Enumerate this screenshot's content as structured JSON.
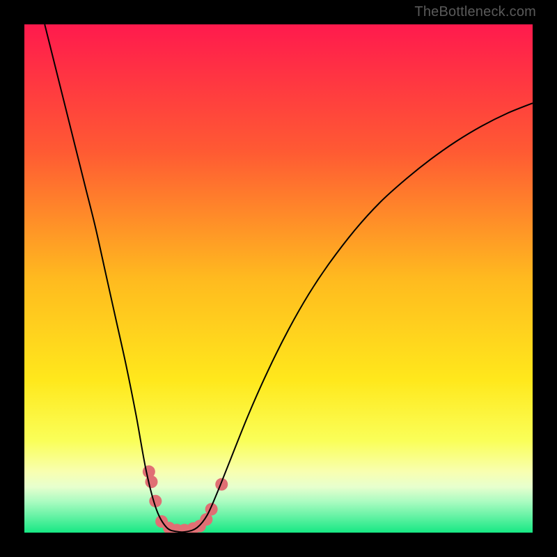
{
  "watermark": "TheBottleneck.com",
  "chart_data": {
    "type": "line",
    "title": "",
    "xlabel": "",
    "ylabel": "",
    "x_range": [
      0,
      100
    ],
    "y_range": [
      0,
      100
    ],
    "background_gradient": {
      "stops": [
        {
          "pos": 0.0,
          "color": "#ff1a4d"
        },
        {
          "pos": 0.25,
          "color": "#ff5a33"
        },
        {
          "pos": 0.5,
          "color": "#ffba1f"
        },
        {
          "pos": 0.7,
          "color": "#ffe81c"
        },
        {
          "pos": 0.82,
          "color": "#faff59"
        },
        {
          "pos": 0.88,
          "color": "#f8ffb0"
        },
        {
          "pos": 0.91,
          "color": "#e7ffce"
        },
        {
          "pos": 0.94,
          "color": "#a8fbc0"
        },
        {
          "pos": 1.0,
          "color": "#17e884"
        }
      ]
    },
    "series": [
      {
        "name": "curve",
        "color": "#000000",
        "width": 2,
        "points": [
          {
            "x": 4.0,
            "y": 100.0
          },
          {
            "x": 6.0,
            "y": 92.0
          },
          {
            "x": 8.0,
            "y": 84.0
          },
          {
            "x": 10.0,
            "y": 76.0
          },
          {
            "x": 12.0,
            "y": 68.0
          },
          {
            "x": 14.0,
            "y": 60.0
          },
          {
            "x": 16.0,
            "y": 51.0
          },
          {
            "x": 18.0,
            "y": 42.0
          },
          {
            "x": 20.0,
            "y": 33.0
          },
          {
            "x": 22.0,
            "y": 23.0
          },
          {
            "x": 24.0,
            "y": 12.0
          },
          {
            "x": 26.0,
            "y": 4.5
          },
          {
            "x": 28.0,
            "y": 1.0
          },
          {
            "x": 30.0,
            "y": 0.2
          },
          {
            "x": 32.0,
            "y": 0.2
          },
          {
            "x": 34.0,
            "y": 1.0
          },
          {
            "x": 36.0,
            "y": 3.5
          },
          {
            "x": 38.0,
            "y": 8.0
          },
          {
            "x": 40.0,
            "y": 13.0
          },
          {
            "x": 44.0,
            "y": 23.0
          },
          {
            "x": 48.0,
            "y": 32.0
          },
          {
            "x": 52.0,
            "y": 40.0
          },
          {
            "x": 56.0,
            "y": 47.0
          },
          {
            "x": 60.0,
            "y": 53.0
          },
          {
            "x": 65.0,
            "y": 59.5
          },
          {
            "x": 70.0,
            "y": 65.0
          },
          {
            "x": 75.0,
            "y": 69.5
          },
          {
            "x": 80.0,
            "y": 73.5
          },
          {
            "x": 85.0,
            "y": 77.0
          },
          {
            "x": 90.0,
            "y": 80.0
          },
          {
            "x": 95.0,
            "y": 82.5
          },
          {
            "x": 100.0,
            "y": 84.5
          }
        ]
      }
    ],
    "markers": {
      "color": "#e06f74",
      "radius": 9,
      "points": [
        {
          "x": 24.5,
          "y": 12.0
        },
        {
          "x": 25.0,
          "y": 10.0
        },
        {
          "x": 25.8,
          "y": 6.2
        },
        {
          "x": 27.0,
          "y": 2.2
        },
        {
          "x": 28.5,
          "y": 0.9
        },
        {
          "x": 30.0,
          "y": 0.5
        },
        {
          "x": 31.5,
          "y": 0.5
        },
        {
          "x": 33.2,
          "y": 0.8
        },
        {
          "x": 34.5,
          "y": 1.3
        },
        {
          "x": 35.8,
          "y": 2.6
        },
        {
          "x": 36.8,
          "y": 4.6
        },
        {
          "x": 38.8,
          "y": 9.5
        }
      ]
    }
  }
}
